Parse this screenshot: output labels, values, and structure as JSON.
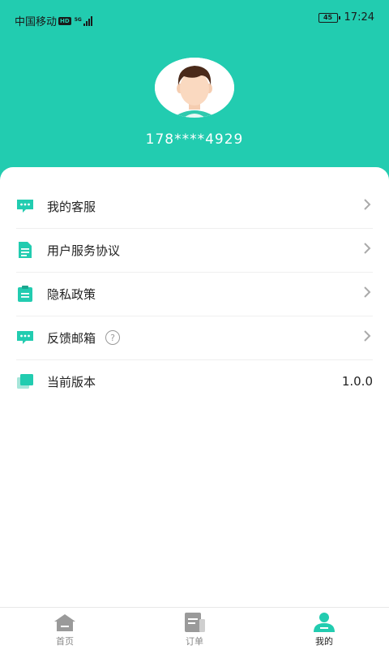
{
  "status_bar": {
    "carrier": "中国移动",
    "hd": "HD",
    "network": "5G",
    "battery": "45",
    "time": "17:24"
  },
  "profile": {
    "phone": "178****4929"
  },
  "menu": [
    {
      "label": "我的客服",
      "icon": "chat-icon"
    },
    {
      "label": "用户服务协议",
      "icon": "document-icon"
    },
    {
      "label": "隐私政策",
      "icon": "clipboard-icon"
    },
    {
      "label": "反馈邮箱",
      "icon": "chat-icon",
      "help": "?"
    },
    {
      "label": "当前版本",
      "icon": "layers-icon",
      "value": "1.0.0"
    }
  ],
  "tabs": [
    {
      "label": "首页",
      "icon": "home-icon"
    },
    {
      "label": "订单",
      "icon": "order-icon"
    },
    {
      "label": "我的",
      "icon": "user-icon",
      "active": true
    }
  ],
  "colors": {
    "accent": "#22ccb0",
    "icon_gray": "#9a9a9a"
  }
}
